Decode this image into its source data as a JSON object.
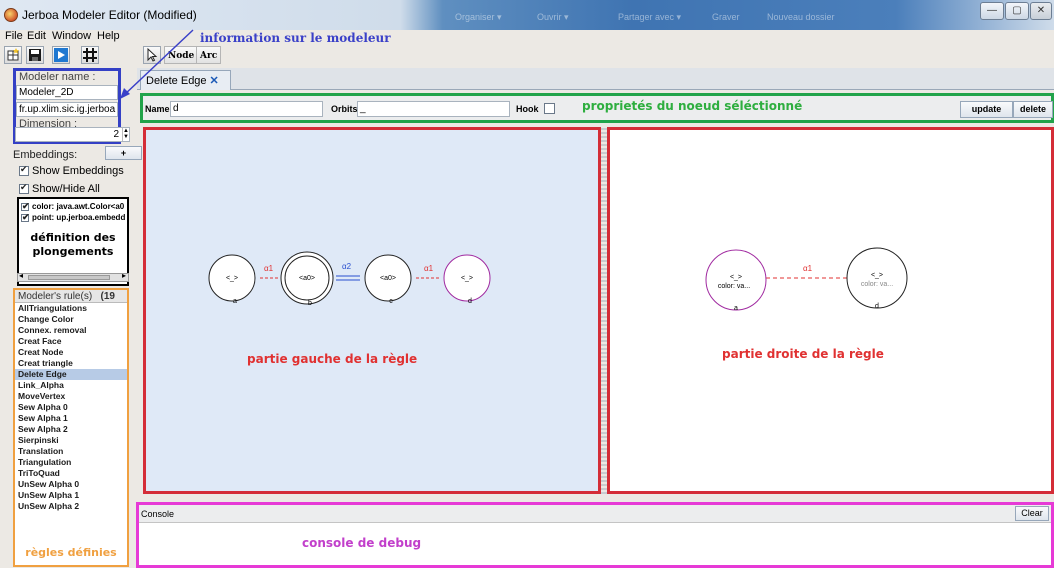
{
  "window": {
    "title": "Jerboa Modeler Editor (Modified)",
    "taskbar_ghost": [
      "Organiser ▾",
      "Ouvrir ▾",
      "Partager avec ▾",
      "Graver",
      "Nouveau dossier"
    ],
    "controls": [
      "—",
      "▢",
      "✕"
    ]
  },
  "menu": [
    "File",
    "Edit",
    "Window",
    "Help"
  ],
  "toolbar": {
    "node_label": "Node",
    "arc_label": "Arc"
  },
  "modeler": {
    "name_label": "Modeler name :",
    "name_value": "Modeler_2D",
    "package_value": "fr.up.xlim.sic.ig.jerboa",
    "dimension_label": "Dimension :",
    "dimension_value": "2"
  },
  "embeddings": {
    "label": "Embeddings:",
    "add_label": "+",
    "show_embeddings": "Show Embeddings",
    "show_hide_all": "Show/Hide All",
    "items": [
      "color: java.awt.Color<a0",
      "point: up.jerboa.embedd"
    ]
  },
  "rules": {
    "header": "Modeler's rule(s)",
    "count": "(19",
    "items": [
      "AllTriangulations",
      "Change Color",
      "Connex. removal",
      "Creat Face",
      "Creat Node",
      "Creat triangle",
      "Delete Edge",
      "Link_Alpha",
      "MoveVertex",
      "Sew Alpha 0",
      "Sew Alpha 1",
      "Sew Alpha 2",
      "Sierpinski",
      "Translation",
      "Triangulation",
      "TriToQuad",
      "UnSew Alpha 0",
      "UnSew Alpha 1",
      "UnSew Alpha 2"
    ],
    "selected": "Delete Edge"
  },
  "tab": {
    "label": "Delete Edge",
    "close": "✕"
  },
  "props": {
    "name_label": "Name",
    "name_value": "d",
    "orbits_label": "Orbits",
    "orbits_value": "_",
    "hook_label": "Hook",
    "update_label": "update",
    "delete_label": "delete"
  },
  "left_rule": {
    "nodes": [
      {
        "inner": "<_>",
        "id": "a",
        "color": "#222222",
        "double": false
      },
      {
        "inner": "<a0>",
        "id": "b",
        "color": "#222222",
        "double": true
      },
      {
        "inner": "<a0>",
        "id": "c",
        "color": "#222222",
        "double": false
      },
      {
        "inner": "<_>",
        "id": "d",
        "color": "#a02aa0",
        "double": false
      }
    ],
    "edges": [
      {
        "label": "α1",
        "color": "#e03131",
        "style": "dashed"
      },
      {
        "label": "α2",
        "color": "#2a4fcf",
        "style": "double"
      },
      {
        "label": "α1",
        "color": "#e03131",
        "style": "dashed"
      }
    ]
  },
  "right_rule": {
    "nodes": [
      {
        "inner": "<_>",
        "sub": "color: va...",
        "id": "a",
        "color": "#a02aa0"
      },
      {
        "inner": "<_>",
        "sub": "color: va...",
        "id": "d",
        "color": "#222222"
      }
    ],
    "edge": {
      "label": "α1",
      "color": "#e03131"
    }
  },
  "console": {
    "label": "Console",
    "clear_label": "Clear"
  },
  "annotations": {
    "modeler": "information sur le modeleur",
    "props": "proprietés du noeud séléctionné",
    "left_rule": "partie gauche de la règle",
    "right_rule": "partie droite de la règle",
    "console": "console de debug",
    "embeddings_line1": "définition des",
    "embeddings_line2": "plongements",
    "rules": "règles définies"
  }
}
